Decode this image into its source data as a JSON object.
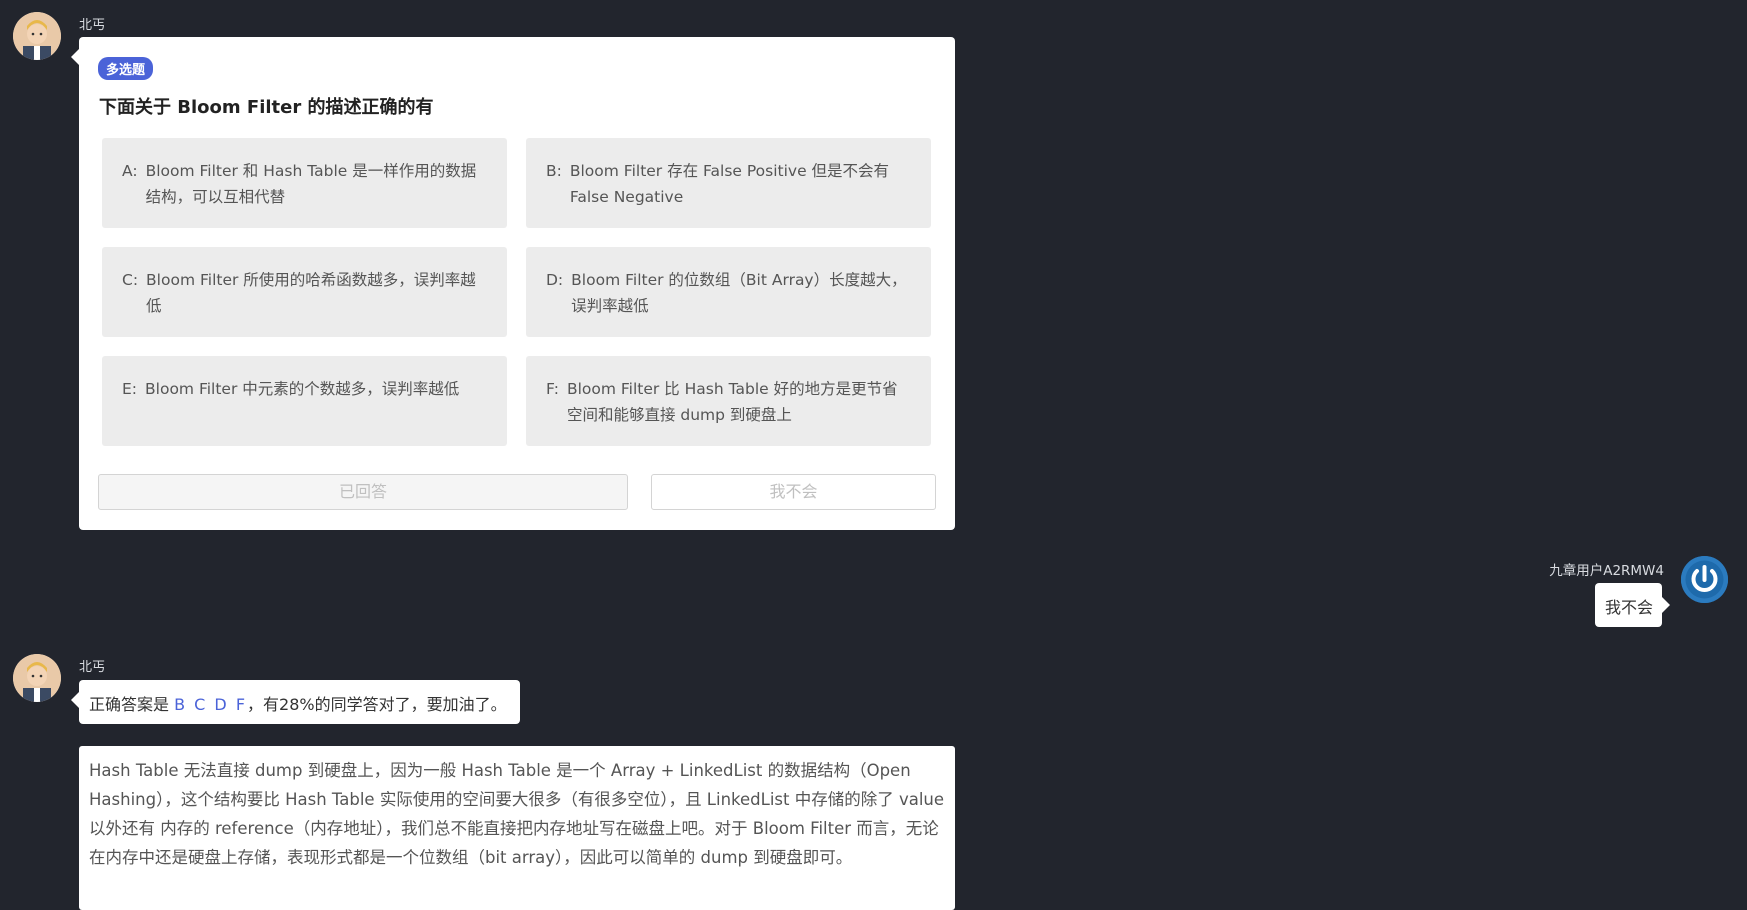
{
  "question_message": {
    "sender": "北丐",
    "badge": "多选题",
    "title": "下面关于 Bloom Filter 的描述正确的有",
    "options": [
      {
        "key": "A:",
        "text": "Bloom Filter 和 Hash Table 是一样作用的数据结构，可以互相代替"
      },
      {
        "key": "B:",
        "text": "Bloom Filter 存在 False Positive 但是不会有 False Negative"
      },
      {
        "key": "C:",
        "text": "Bloom Filter 所使用的哈希函数越多，误判率越低"
      },
      {
        "key": "D:",
        "text": "Bloom Filter 的位数组（Bit Array）长度越大，误判率越低"
      },
      {
        "key": "E:",
        "text": "Bloom Filter 中元素的个数越多，误判率越低"
      },
      {
        "key": "F:",
        "text": "Bloom Filter 比 Hash Table 好的地方是更节省空间和能够直接 dump 到硬盘上"
      }
    ],
    "answered_button": "已回答",
    "dont_know_button": "我不会"
  },
  "user_message": {
    "sender": "九章用户A2RMW4",
    "text": "我不会"
  },
  "answer_message": {
    "sender": "北丐",
    "prefix": "正确答案是",
    "letters": "B C D F",
    "suffix": "，有28%的同学答对了，要加油了。",
    "explanation": "Hash Table 无法直接 dump 到硬盘上，因为一般 Hash Table 是一个 Array + LinkedList 的数据结构（Open Hashing），这个结构要比 Hash Table 实际使用的空间要大很多（有很多空位），且 LinkedList 中存储的除了 value 以外还有 内存的 reference（内存地址），我们总不能直接把内存地址写在磁盘上吧。对于 Bloom Filter 而言，无论在内存中还是硬盘上存储，表现形式都是一个位数组（bit array），因此可以简单的 dump 到硬盘即可。"
  },
  "colors": {
    "background": "#22252d",
    "accent": "#4b63d8",
    "option_bg": "#ececec"
  }
}
